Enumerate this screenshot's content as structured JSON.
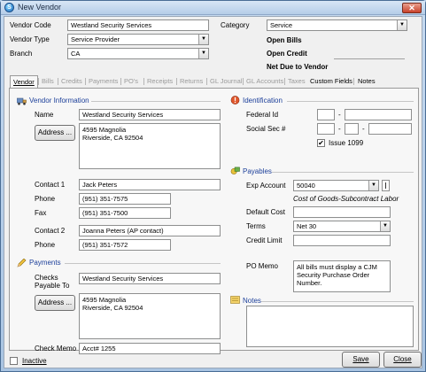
{
  "window": {
    "title": "New Vendor",
    "close_glyph": "✕",
    "app_icon_letter": "S"
  },
  "header": {
    "vendor_code_label": "Vendor Code",
    "vendor_code_value": "Westland Security Services",
    "vendor_type_label": "Vendor Type",
    "vendor_type_value": "Service Provider",
    "branch_label": "Branch",
    "branch_value": "CA",
    "category_label": "Category",
    "category_value": "Service",
    "open_bills_label": "Open Bills",
    "open_credit_label": "Open Credit",
    "net_due_label": "Net Due to Vendor"
  },
  "tabs": [
    {
      "label": "Vendor",
      "state": "active"
    },
    {
      "label": "Bills",
      "state": "disabled"
    },
    {
      "label": "Credits",
      "state": "disabled"
    },
    {
      "label": "Payments",
      "state": "disabled"
    },
    {
      "label": "PO's",
      "state": "disabled"
    },
    {
      "label": "Receipts",
      "state": "disabled"
    },
    {
      "label": "Returns",
      "state": "disabled"
    },
    {
      "label": "GL Journal",
      "state": "disabled"
    },
    {
      "label": "GL Accounts",
      "state": "disabled"
    },
    {
      "label": "Taxes",
      "state": "disabled"
    },
    {
      "label": "Custom Fields",
      "state": "enabled"
    },
    {
      "label": "Notes",
      "state": "enabled"
    }
  ],
  "vendor_info": {
    "section_title": "Vendor Information",
    "name_label": "Name",
    "name_value": "Westland Security Services",
    "address_button": "Address ...",
    "address_value": "4595 Magnolia\nRiverside, CA  92504",
    "contact1_label": "Contact 1",
    "contact1_value": "Jack Peters",
    "phone_label": "Phone",
    "phone_value": "(951) 351-7575",
    "fax_label": "Fax",
    "fax_value": "(951) 351-7500",
    "contact2_label": "Contact 2",
    "contact2_value": "Joanna Peters (AP contact)",
    "phone2_label": "Phone",
    "phone2_value": "(951) 351-7572"
  },
  "payments": {
    "section_title": "Payments",
    "checks_payable_label": "Checks\nPayable To",
    "checks_payable_value": "Westland Security Services",
    "address_button": "Address ...",
    "address_value": "4595 Magnolia\nRiverside, CA  92504",
    "check_memo_label": "Check Memo",
    "check_memo_value": "Acct# 1255"
  },
  "identification": {
    "section_title": "Identification",
    "federal_id_label": "Federal Id",
    "federal_id_dash": "-",
    "social_sec_label": "Social Sec #",
    "social_sec_dash1": "-",
    "social_sec_dash2": "-",
    "issue_1099_label": "Issue 1099",
    "issue_1099_checked": true,
    "check_glyph": "✔"
  },
  "payables": {
    "section_title": "Payables",
    "exp_account_label": "Exp Account",
    "exp_account_value": "50040",
    "exp_account_desc": "Cost of Goods-Subcontract Labor",
    "default_cost_label": "Default Cost",
    "default_cost_value": "",
    "terms_label": "Terms",
    "terms_value": "Net 30",
    "credit_limit_label": "Credit Limit",
    "credit_limit_value": "",
    "po_memo_label": "PO Memo",
    "po_memo_value": "All bills must display a CJM Security Purchase Order Number."
  },
  "notes": {
    "section_title": "Notes",
    "value": ""
  },
  "footer": {
    "inactive_label": "Inactive",
    "inactive_checked": false,
    "save_button": "Save",
    "close_button": "Close"
  },
  "icons": {
    "app": "app-logo-icon",
    "vendor_info": "truck-icon",
    "payments": "pencil-icon",
    "identification": "alert-icon",
    "payables": "money-icon",
    "notes": "note-icon"
  },
  "colors": {
    "section_title": "#1c3f9a",
    "window_frame": "#4a6d95",
    "close_button": "#c8412a"
  }
}
